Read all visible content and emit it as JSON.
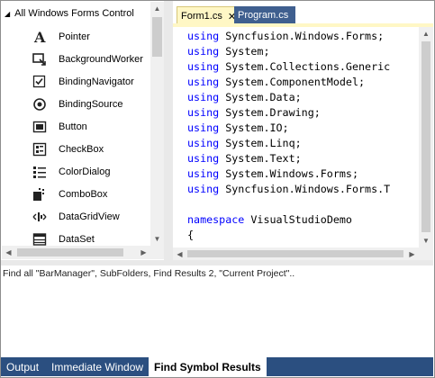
{
  "toolbox": {
    "header": "All Windows Forms Control",
    "items": [
      {
        "label": "Pointer",
        "icon": "pointer-icon"
      },
      {
        "label": "BackgroundWorker",
        "icon": "background-worker-icon"
      },
      {
        "label": "BindingNavigator",
        "icon": "binding-navigator-icon"
      },
      {
        "label": "BindingSource",
        "icon": "binding-source-icon"
      },
      {
        "label": "Button",
        "icon": "button-icon"
      },
      {
        "label": "CheckBox",
        "icon": "checkbox-icon"
      },
      {
        "label": "ColorDialog",
        "icon": "color-dialog-icon"
      },
      {
        "label": "ComboBox",
        "icon": "combobox-icon"
      },
      {
        "label": "DataGridView",
        "icon": "datagridview-icon"
      },
      {
        "label": "DataSet",
        "icon": "dataset-icon"
      }
    ]
  },
  "editor": {
    "tabs": [
      {
        "label": "Form1.cs",
        "active": true
      },
      {
        "label": "Program.cs",
        "active": false
      }
    ],
    "lines": [
      {
        "kw": "using",
        "text": " Syncfusion.Windows.Forms;"
      },
      {
        "kw": "using",
        "text": " System;"
      },
      {
        "kw": "using",
        "text": " System.Collections.Generic"
      },
      {
        "kw": "using",
        "text": " System.ComponentModel;"
      },
      {
        "kw": "using",
        "text": " System.Data;"
      },
      {
        "kw": "using",
        "text": " System.Drawing;"
      },
      {
        "kw": "using",
        "text": " System.IO;"
      },
      {
        "kw": "using",
        "text": " System.Linq;"
      },
      {
        "kw": "using",
        "text": " System.Text;"
      },
      {
        "kw": "using",
        "text": " System.Windows.Forms;"
      },
      {
        "kw": "using",
        "text": " Syncfusion.Windows.Forms.T"
      },
      {
        "kw": "",
        "text": ""
      },
      {
        "kw": "namespace",
        "text": " VisualStudioDemo"
      },
      {
        "kw": "",
        "text": "{"
      }
    ]
  },
  "results": {
    "text": "Find all \"BarManager\", SubFolders, Find Results 2, \"Current Project\".."
  },
  "bottom_tabs": [
    {
      "label": "Output",
      "active": false
    },
    {
      "label": "Immediate Window",
      "active": false
    },
    {
      "label": "Find Symbol Results",
      "active": true
    }
  ],
  "colors": {
    "active_tab": "#fff7c5",
    "inactive_tab": "#3f5f8f",
    "bottom_bar": "#2b4f80",
    "keyword": "#0000ff"
  }
}
